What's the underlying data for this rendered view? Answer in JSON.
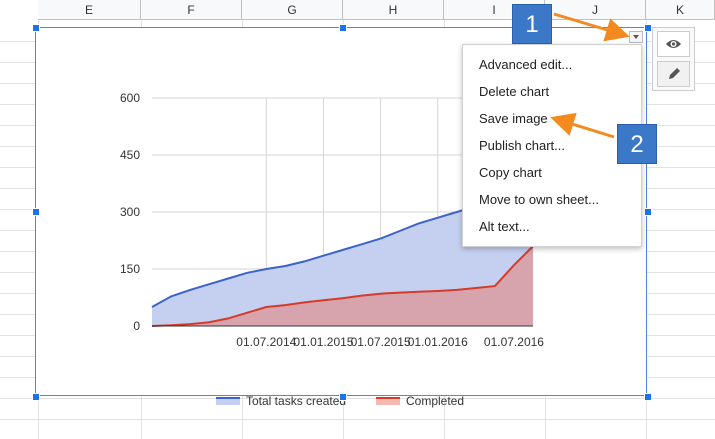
{
  "sheet": {
    "columns": [
      "E",
      "F",
      "G",
      "H",
      "I",
      "J",
      "K"
    ]
  },
  "chart_data": {
    "type": "area",
    "x": [
      "01.07.2013",
      "01.09.2013",
      "01.11.2013",
      "01.01.2014",
      "01.03.2014",
      "01.05.2014",
      "01.07.2014",
      "01.09.2014",
      "01.11.2014",
      "01.01.2015",
      "01.03.2015",
      "01.05.2015",
      "01.07.2015",
      "01.09.2015",
      "01.11.2015",
      "01.01.2016",
      "01.03.2016",
      "01.05.2016",
      "01.06.2016",
      "01.07.2016",
      "01.08.2016"
    ],
    "series": [
      {
        "name": "Total tasks created",
        "values": [
          50,
          78,
          95,
          110,
          125,
          140,
          150,
          158,
          170,
          185,
          200,
          215,
          230,
          250,
          270,
          285,
          300,
          315,
          325,
          330,
          340
        ],
        "color": "#3b63c9"
      },
      {
        "name": "Completed",
        "values": [
          0,
          2,
          5,
          10,
          20,
          35,
          50,
          55,
          62,
          68,
          73,
          80,
          85,
          88,
          90,
          92,
          95,
          100,
          105,
          160,
          210
        ],
        "color": "#d63a2a"
      }
    ],
    "xticks": [
      "01.07.2014",
      "01.01.2015",
      "01.07.2015",
      "01.01.2016",
      "01.07.2016"
    ],
    "yticks": [
      "0",
      "150",
      "300",
      "450",
      "600"
    ],
    "ylim": [
      0,
      600
    ],
    "grid": true,
    "legend_placement": "bottom"
  },
  "menu": {
    "items": [
      "Advanced edit...",
      "Delete chart",
      "Save image",
      "Publish chart...",
      "Copy chart",
      "Move to own sheet...",
      "Alt text..."
    ]
  },
  "annotations": {
    "badge1": "1",
    "badge2": "2",
    "arrow_color": "#f28a1f"
  },
  "icons": {
    "preview": "eye-icon",
    "edit": "pencil-icon",
    "dropdown": "chevron-down-icon"
  }
}
